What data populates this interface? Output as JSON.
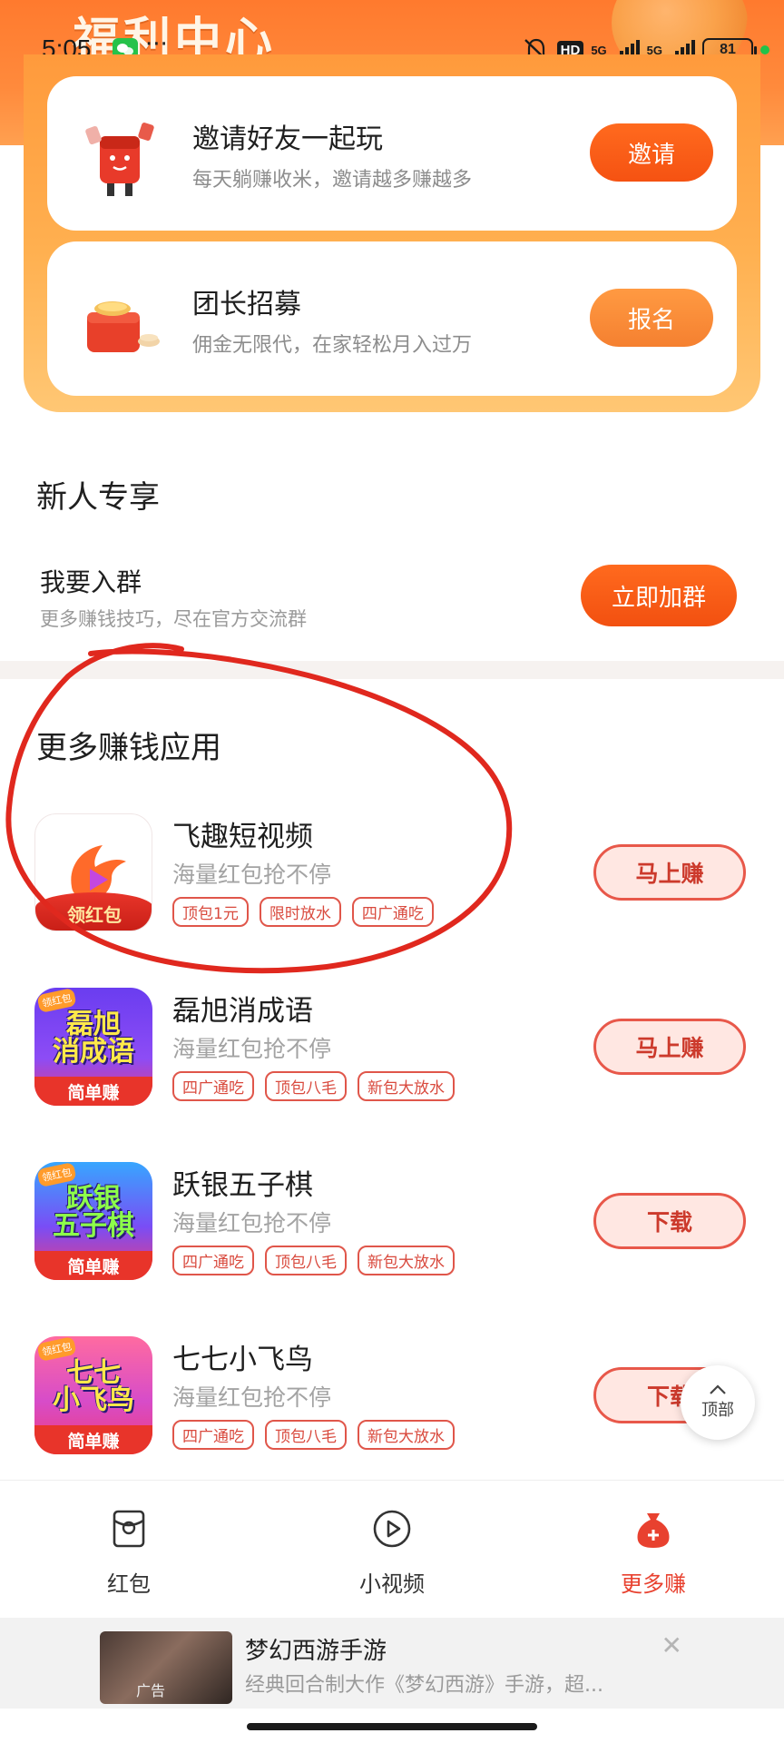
{
  "status": {
    "time": "5:05",
    "dots": "···",
    "hd": "HD",
    "net1": "5G",
    "net2": "5G",
    "battery": "81"
  },
  "hero": {
    "title": "福利中心"
  },
  "promos": [
    {
      "title": "邀请好友一起玩",
      "subtitle": "每天躺赚收米，邀请越多赚越多",
      "button": "邀请"
    },
    {
      "title": "团长招募",
      "subtitle": "佣金无限代，在家轻松月入过万",
      "button": "报名"
    }
  ],
  "newcomer": {
    "title": "新人专享",
    "join_title": "我要入群",
    "join_subtitle": "更多赚钱技巧，尽在官方交流群",
    "join_button": "立即加群"
  },
  "more_apps": {
    "title": "更多赚钱应用",
    "items": [
      {
        "name": "飞趣短视频",
        "desc": "海量红包抢不停",
        "tags": [
          "顶包1元",
          "限时放水",
          "四广通吃"
        ],
        "button": "马上赚",
        "icon_name": "feiqu-app-icon",
        "icon_text": "领红包"
      },
      {
        "name": "磊旭消成语",
        "desc": "海量红包抢不停",
        "tags": [
          "四广通吃",
          "顶包八毛",
          "新包大放水"
        ],
        "button": "马上赚",
        "icon_name": "idiom-game-icon",
        "icon_big": "磊旭\n消成语",
        "icon_bar": "简单赚",
        "icon_corner": "领红包"
      },
      {
        "name": "跃银五子棋",
        "desc": "海量红包抢不停",
        "tags": [
          "四广通吃",
          "顶包八毛",
          "新包大放水"
        ],
        "button": "下载",
        "icon_name": "gomoku-game-icon",
        "icon_big": "跃银\n五子棋",
        "icon_bar": "简单赚",
        "icon_corner": "领红包"
      },
      {
        "name": "七七小飞鸟",
        "desc": "海量红包抢不停",
        "tags": [
          "四广通吃",
          "顶包八毛",
          "新包大放水"
        ],
        "button": "下载",
        "icon_name": "bird-game-icon",
        "icon_big": "七七\n小飞鸟",
        "icon_bar": "简单赚",
        "icon_corner": "领红包"
      }
    ]
  },
  "top_button": {
    "label": "顶部"
  },
  "bottom_nav": [
    {
      "label": "红包",
      "icon": "red-envelope-icon",
      "active": false
    },
    {
      "label": "小视频",
      "icon": "play-icon",
      "active": false
    },
    {
      "label": "更多赚",
      "icon": "money-bag-icon",
      "active": true
    }
  ],
  "ad": {
    "title": "梦幻西游手游",
    "subtitle": "经典回合制大作《梦幻西游》手游，超...",
    "tag": "广告",
    "close": "✕"
  },
  "colors": {
    "accent": "#f55212",
    "tag_red": "#e0564a",
    "active_nav": "#e8412f",
    "hero_orange": "#ff7a2e"
  }
}
